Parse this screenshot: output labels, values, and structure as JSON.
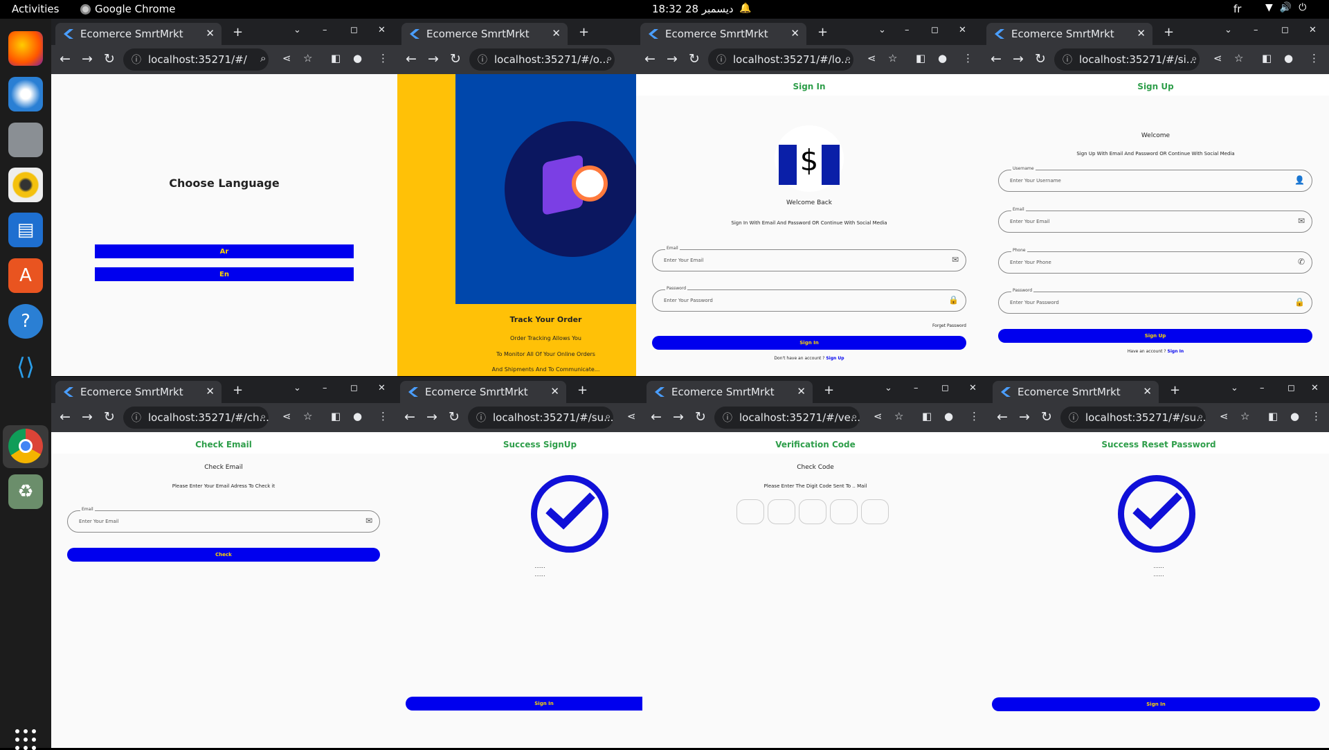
{
  "topbar": {
    "activities": "Activities",
    "app": "Google Chrome",
    "clock": "18:32  28 ديسمبر",
    "lang": "fr"
  },
  "dock": {
    "items": [
      "firefox-icon",
      "thunderbird-icon",
      "files-icon",
      "rhythmbox-icon",
      "writer-icon",
      "app-center-icon",
      "help-icon",
      "vscode-icon",
      "chrome-icon",
      "trash-icon",
      "app-grid-icon"
    ]
  },
  "windows": [
    {
      "tab": "Ecomerce SmrtMrkt",
      "url": "localhost:35271/#/"
    },
    {
      "tab": "Ecomerce SmrtMrkt",
      "url": "localhost:35271/#/o..."
    },
    {
      "tab": "Ecomerce SmrtMrkt",
      "url": "localhost:35271/#/lo..."
    },
    {
      "tab": "Ecomerce SmrtMrkt",
      "url": "localhost:35271/#/si..."
    },
    {
      "tab": "Ecomerce SmrtMrkt",
      "url": "localhost:35271/#/ch..."
    },
    {
      "tab": "Ecomerce SmrtMrkt",
      "url": "localhost:35271/#/su..."
    },
    {
      "tab": "Ecomerce SmrtMrkt",
      "url": "localhost:35271/#/ve..."
    },
    {
      "tab": "Ecomerce SmrtMrkt",
      "url": "localhost:35271/#/su..."
    }
  ],
  "lang": {
    "title": "Choose Language",
    "ar": "Ar",
    "en": "En"
  },
  "onboard": {
    "title": "Track Your Order",
    "l1": "Order Tracking Allows You",
    "l2": "To Monitor All Of Your Online Orders",
    "l3": "And Shipments And To Communicate..."
  },
  "signin": {
    "header": "Sign In",
    "welcome": "Welcome Back",
    "sub": "Sign In With Email And Password OR Continue With Social Media",
    "email_label": "Email",
    "email_ph": "Enter Your Email",
    "pass_label": "Password",
    "pass_ph": "Enter Your Password",
    "forget": "Forget Password",
    "button": "Sign In",
    "noacc": "Don't have an account ?",
    "signup_link": "Sign Up"
  },
  "signup": {
    "header": "Sign Up",
    "welcome": "Welcome",
    "sub": "Sign Up With Email And Password OR Continue With Social Media",
    "user_label": "Username",
    "user_ph": "Enter Your Username",
    "email_label": "Email",
    "email_ph": "Enter Your Email",
    "phone_label": "Phone",
    "phone_ph": "Enter Your Phone",
    "pass_label": "Password",
    "pass_ph": "Enter Your Password",
    "button": "Sign Up",
    "haveacc": "Have an account ?",
    "signin_link": "Sign In"
  },
  "checkemail": {
    "header": "Check Email",
    "title": "Check Email",
    "sub": "Please Enter Your Email Adress To Check it",
    "email_label": "Email",
    "email_ph": "Enter Your Email",
    "button": "Check"
  },
  "successsignup": {
    "header": "Success SignUp",
    "dots1": "......",
    "dots2": "......",
    "button": "Sign In"
  },
  "verify": {
    "header": "Verification Code",
    "title": "Check Code",
    "sub": "Please Enter The Digit Code Sent To .. Mail"
  },
  "successreset": {
    "header": "Success Reset Password",
    "dots1": "......",
    "dots2": "......",
    "button": "Sign In"
  },
  "colors": {
    "accent_blue": "#0000ee",
    "button_text": "#ffd700",
    "header_green": "#2e9e4a",
    "onboard_yellow": "#ffc107",
    "onboard_blue": "#0047ab"
  }
}
